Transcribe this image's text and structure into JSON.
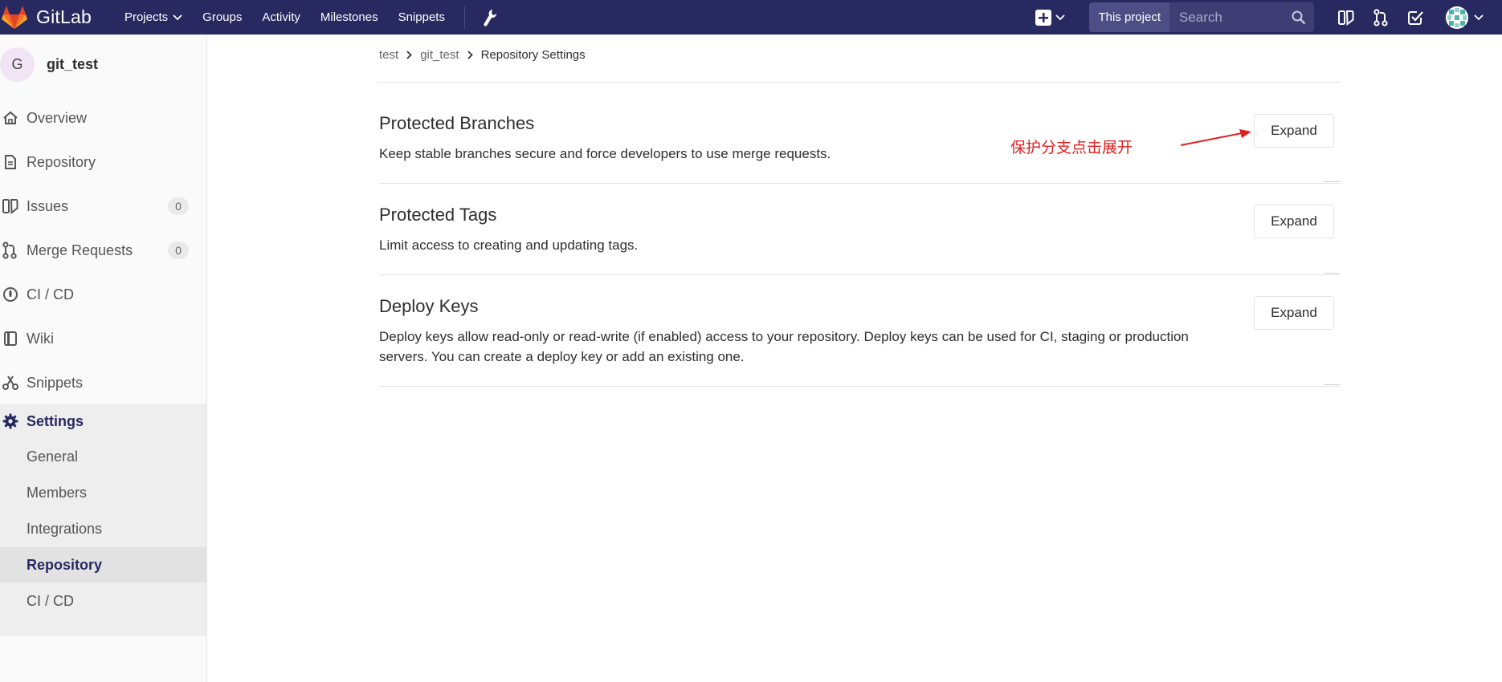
{
  "navbar": {
    "brand": "GitLab",
    "links": [
      "Projects",
      "Groups",
      "Activity",
      "Milestones",
      "Snippets"
    ],
    "search_scope": "This project",
    "search_placeholder": "Search",
    "bg_color": "#292961"
  },
  "sidebar": {
    "project_initial": "G",
    "project_name": "git_test",
    "items": [
      {
        "label": "Overview",
        "icon": "home-icon"
      },
      {
        "label": "Repository",
        "icon": "doc-icon"
      },
      {
        "label": "Issues",
        "icon": "issues-icon",
        "count": "0"
      },
      {
        "label": "Merge Requests",
        "icon": "merge-request-icon",
        "count": "0"
      },
      {
        "label": "CI / CD",
        "icon": "rocket-icon"
      },
      {
        "label": "Wiki",
        "icon": "book-icon"
      },
      {
        "label": "Snippets",
        "icon": "scissors-icon"
      },
      {
        "label": "Settings",
        "icon": "gear-icon"
      }
    ],
    "settings_sub": [
      "General",
      "Members",
      "Integrations",
      "Repository",
      "CI / CD"
    ]
  },
  "breadcrumb": {
    "group": "test",
    "project": "git_test",
    "current": "Repository Settings"
  },
  "sections": [
    {
      "title": "Protected Branches",
      "description": "Keep stable branches secure and force developers to use merge requests.",
      "button": "Expand"
    },
    {
      "title": "Protected Tags",
      "description": "Limit access to creating and updating tags.",
      "button": "Expand"
    },
    {
      "title": "Deploy Keys",
      "description": "Deploy keys allow read-only or read-write (if enabled) access to your repository. Deploy keys can be used for CI, staging or production servers. You can create a deploy key or add an existing one.",
      "button": "Expand"
    }
  ],
  "annotation": {
    "text": "保护分支点击展开",
    "color": "#e02020"
  }
}
